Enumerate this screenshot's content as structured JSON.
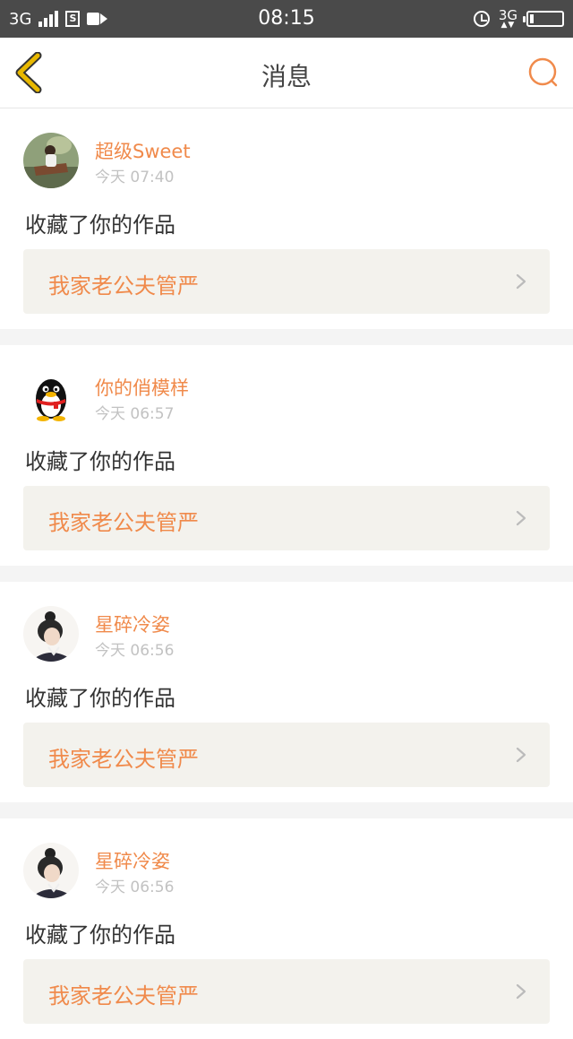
{
  "status_bar": {
    "network_left": "3G",
    "sim_label": "S",
    "time": "08:15",
    "network_right": "3G"
  },
  "nav": {
    "title": "消息",
    "back_icon": "chevron-left-icon",
    "search_icon": "search-icon"
  },
  "colors": {
    "accent": "#f08a4b",
    "back_icon": "#e8b800"
  },
  "messages": [
    {
      "user": "超级Sweet",
      "time": "今天 07:40",
      "action": "收藏了你的作品",
      "work_title": "我家老公夫管严",
      "avatar": "girl-landscape-avatar"
    },
    {
      "user": "你的俏模样",
      "time": "今天 06:57",
      "action": "收藏了你的作品",
      "work_title": "我家老公夫管严",
      "avatar": "qq-penguin-avatar"
    },
    {
      "user": "星碎冷姿",
      "time": "今天 06:56",
      "action": "收藏了你的作品",
      "work_title": "我家老公夫管严",
      "avatar": "girl-bun-avatar"
    },
    {
      "user": "星碎冷姿",
      "time": "今天 06:56",
      "action": "收藏了你的作品",
      "work_title": "我家老公夫管严",
      "avatar": "girl-bun-avatar"
    }
  ]
}
